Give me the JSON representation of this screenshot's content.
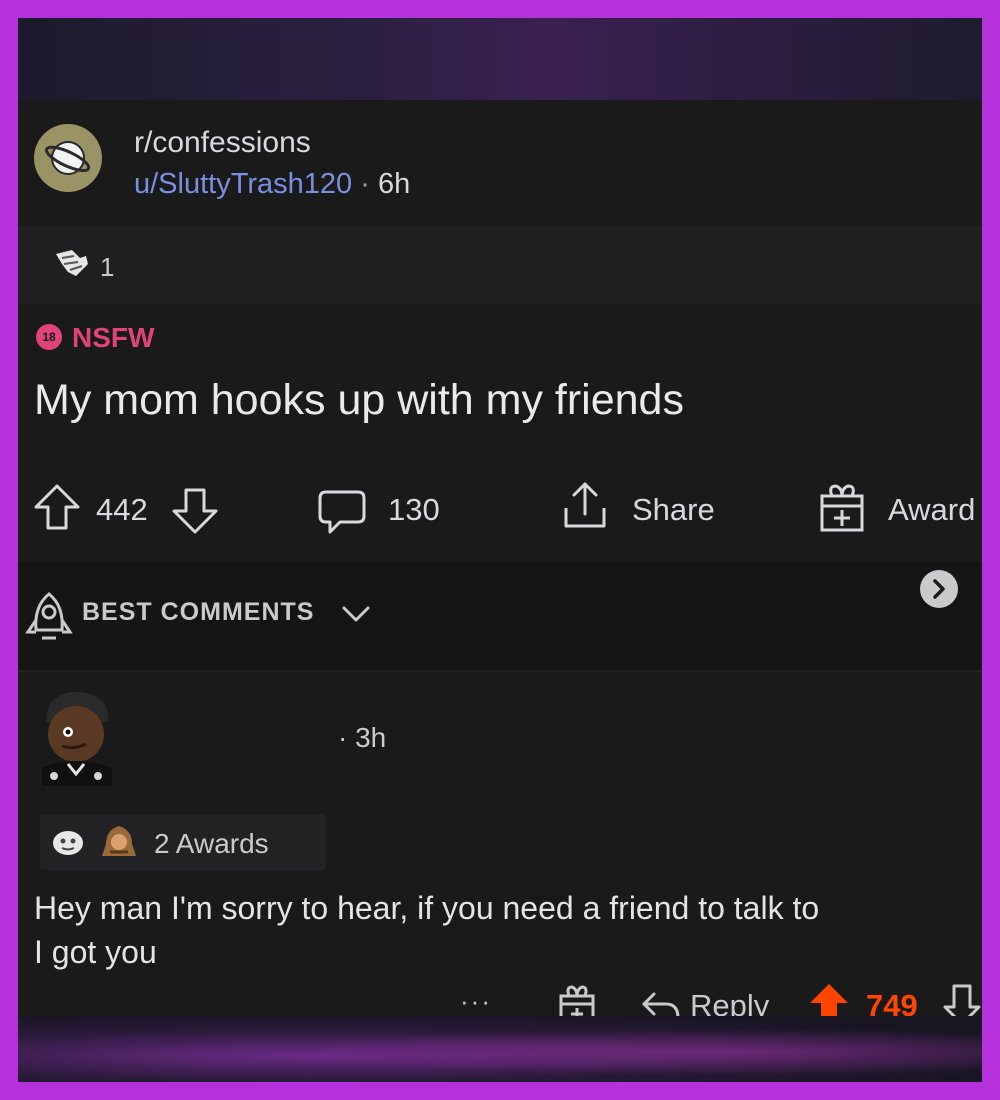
{
  "post": {
    "subreddit": "r/confessions",
    "username": "u/SluttyTrash120",
    "separator": "·",
    "time": "6h",
    "award_count": "1",
    "nsfw_badge": "18",
    "nsfw_label": "NSFW",
    "title": "My mom hooks up with my friends",
    "vote_count": "442",
    "comment_count": "130",
    "share_label": "Share",
    "award_label": "Award"
  },
  "sort": {
    "label": "BEST COMMENTS"
  },
  "comment": {
    "time": "· 3h",
    "awards_label": "2 Awards",
    "body": "Hey man I'm sorry to hear, if you need a friend to talk to\nI got you",
    "more": "···",
    "reply_label": "Reply",
    "score": "749"
  },
  "colors": {
    "frame": "#b531dc",
    "background": "#1a1a1b",
    "username": "#7a8fe0",
    "nsfw": "#e0427a",
    "upvote_active": "#ff4500"
  },
  "icons": [
    "subreddit-icon",
    "award-icon",
    "nsfw-icon",
    "upvote-icon",
    "downvote-icon",
    "comment-icon",
    "share-icon",
    "gift-icon",
    "sort-icon",
    "chevron-down-icon",
    "chevron-right-icon",
    "avatar",
    "more-icon",
    "reply-icon"
  ]
}
